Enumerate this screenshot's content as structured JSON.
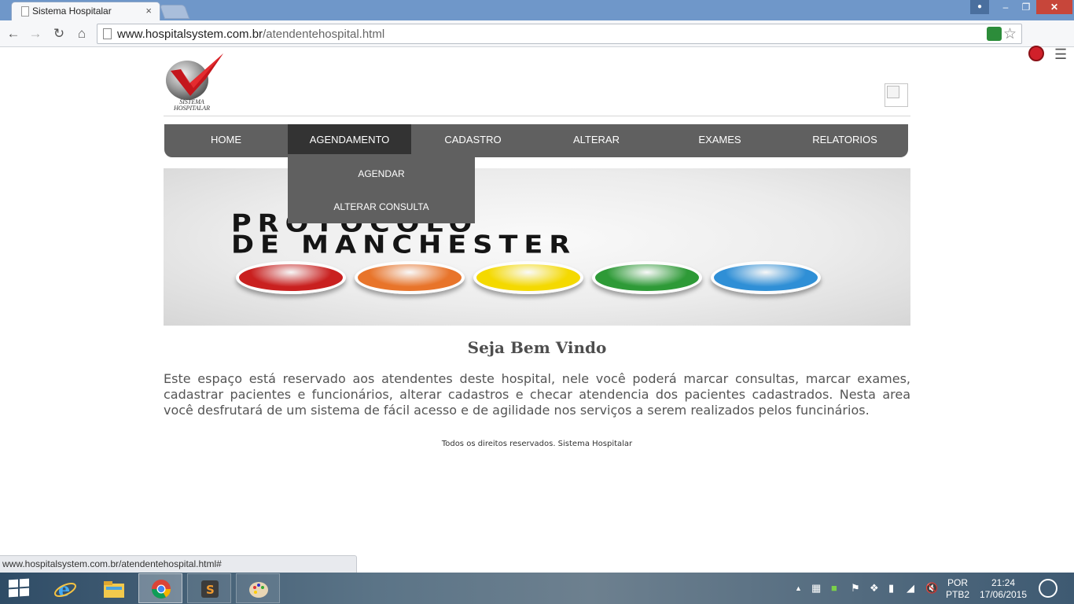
{
  "browser": {
    "tab_title": "Sistema Hospitalar",
    "tab_close": "×",
    "url_host": "www.hospitalsystem.com.br",
    "url_path": "/atendentehospital.html",
    "status_url": "www.hospitalsystem.com.br/atendentehospital.html#"
  },
  "header": {
    "logo_text_line1": "SISTEMA",
    "logo_text_line2": "HOSPITALAR"
  },
  "nav": {
    "items": [
      {
        "label": "HOME"
      },
      {
        "label": "AGENDAMENTO"
      },
      {
        "label": "CADASTRO"
      },
      {
        "label": "ALTERAR"
      },
      {
        "label": "EXAMES"
      },
      {
        "label": "RELATORIOS"
      }
    ],
    "active_index": 1,
    "dropdown": [
      {
        "label": "AGENDAR"
      },
      {
        "label": "ALTERAR CONSULTA"
      }
    ]
  },
  "banner": {
    "line1": "PROTOCOLO",
    "line2": "DE MANCHESTER",
    "light_colors": [
      "#c9201f",
      "#e8742a",
      "#f4d900",
      "#2e9a37",
      "#2f8fd6"
    ]
  },
  "content": {
    "welcome_title": "Seja Bem Vindo",
    "intro": "Este espaço está reservado aos atendentes deste hospital, nele você poderá marcar consultas, marcar exames, cadastrar pacientes e funcionários, alterar cadastros e checar atendencia dos pacientes cadastrados. Nesta area você desfrutará de um sistema de fácil acesso e de agilidade nos serviços a serem realizados pelos funcinários.",
    "footer": "Todos os direitos reservados. Sistema Hospitalar"
  },
  "taskbar": {
    "language_line1": "POR",
    "language_line2": "PTB2",
    "time": "21:24",
    "date": "17/06/2015"
  },
  "colors": {
    "nav_bg": "#606060",
    "nav_active": "#333333",
    "text_gray": "#555555"
  }
}
